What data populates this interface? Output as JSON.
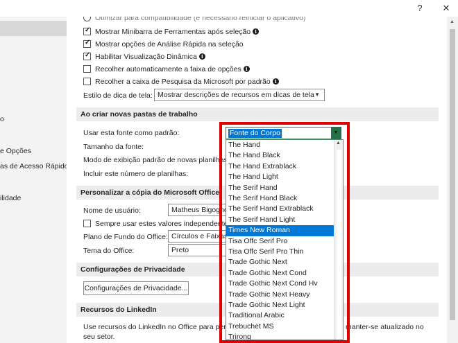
{
  "titlebar": {
    "help": "?",
    "close": "✕"
  },
  "sidebar": {
    "items": [
      "o",
      "e Opções",
      "as de Acesso Rápido",
      "ilidade"
    ]
  },
  "options": {
    "top_partial": "Otimizar para compatibilidade (é necessário reiniciar o aplicativo)",
    "mini_toolbar": "Mostrar Minibarra de Ferramentas após seleção",
    "quick_analysis": "Mostrar opções de Análise Rápida na seleção",
    "live_preview": "Habilitar Visualização Dinâmica",
    "collapse_ribbon": "Recolher automaticamente a faixa de opções",
    "collapse_search": "Recolher a caixa de Pesquisa da Microsoft por padrão",
    "tooltip_label": "Estilo de dica de tela:",
    "tooltip_value": "Mostrar descrições de recursos em dicas de tela"
  },
  "new_workbooks": {
    "header": "Ao criar novas pastas de trabalho",
    "font_label": "Usar esta fonte como padrão:",
    "font_value": "Fonte do Corpo",
    "size_label": "Tamanho da fonte:",
    "view_label": "Modo de exibição padrão de novas planilhas:",
    "sheets_label": "Incluir este número de planilhas:"
  },
  "personalize": {
    "header": "Personalizar a cópia do Microsoft Office",
    "user_label": "Nome de usuário:",
    "user_value": "Matheus Bigogno",
    "always_use": "Sempre usar estes valores independentemente",
    "background_label": "Plano de Fundo do Office:",
    "background_value": "Círculos e Faixas",
    "theme_label": "Tema do Office:",
    "theme_value": "Preto"
  },
  "privacy": {
    "header": "Configurações de Privacidade",
    "button": "Configurações de Privacidade..."
  },
  "linkedin": {
    "header": "Recursos do LinkedIn",
    "text_left": "Use recursos do LinkedIn no Office para perm",
    "text_right": "l e manter-se atualizado no",
    "text_line2": "seu setor."
  },
  "font_list": {
    "items": [
      "The Hand",
      "The Hand Black",
      "The Hand Extrablack",
      "The Hand Light",
      "The Serif Hand",
      "The Serif Hand Black",
      "The Serif Hand Extrablack",
      "The Serif Hand Light",
      "Times New Roman",
      "Tisa Offc Serif Pro",
      "Tisa Offc Serif Pro Thin",
      "Trade Gothic Next",
      "Trade Gothic Next Cond",
      "Trade Gothic Next Cond Hv",
      "Trade Gothic Next Heavy",
      "Trade Gothic Next Light",
      "Traditional Arabic",
      "Trebuchet MS",
      "Trirong"
    ],
    "selected": "Times New Roman"
  },
  "colors": {
    "accent": "#217346",
    "selection": "#0078d7",
    "highlight": "#e00000"
  }
}
